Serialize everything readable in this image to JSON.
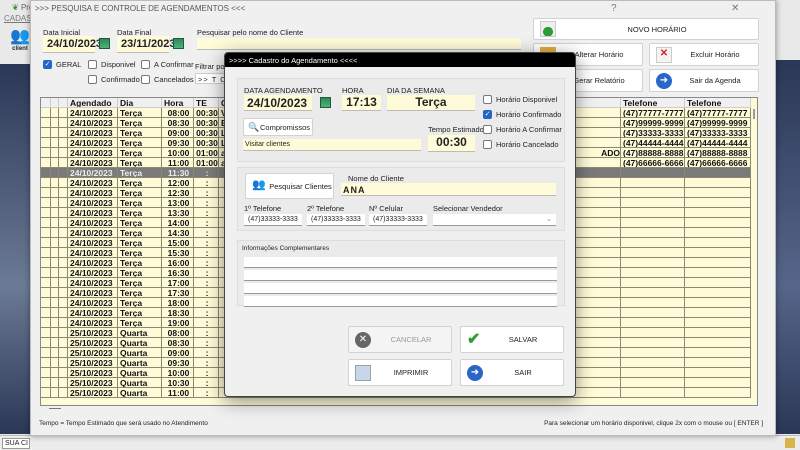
{
  "back_app": {
    "title": "Pro",
    "menu": "CADAS",
    "clientes_label": "client",
    "status_cell": "SUA CI"
  },
  "window": {
    "title": ">>>  PESQUISA E CONTROLE DE AGENDAMENTOS  <<<",
    "help": "?",
    "close": "✕",
    "outer_close": "✕"
  },
  "filters": {
    "data_inicial_label": "Data Inicial",
    "data_inicial": "24/10/2023",
    "data_final_label": "Data Final",
    "data_final": "23/11/2023",
    "search_label": "Pesquisar pelo nome do Cliente",
    "search_value": "",
    "geral": "GERAL",
    "disponivel": "Disponivel",
    "a_confirmar": "A Confirmar",
    "confirmado": "Confirmado",
    "cancelados": "Cancelados",
    "filtrar_label": "Filtrar por",
    "filtrar_value": ">> T O"
  },
  "actions": {
    "novo": "NOVO HORÁRIO",
    "alterar": "Alterar Horário",
    "excluir": "Excluir Horário",
    "relatorio": "Gerar Relatório",
    "sair": "Sair da Agenda"
  },
  "grid": {
    "headers": [
      "",
      "",
      "",
      "Agendado",
      "Dia",
      "Hora",
      "TE",
      "C",
      "",
      "Telefone",
      "Telefone"
    ],
    "rows": [
      [
        "24/10/2023",
        "Terça",
        "08:00",
        "00:30",
        "V",
        "",
        "(47)77777-7777",
        "(47)77777-7777"
      ],
      [
        "24/10/2023",
        "Terça",
        "08:30",
        "00:30",
        "E",
        "",
        "(47)99999-9999",
        "(47)99999-9999"
      ],
      [
        "24/10/2023",
        "Terça",
        "09:00",
        "00:30",
        "Li",
        "",
        "(47)33333-3333",
        "(47)33333-3333"
      ],
      [
        "24/10/2023",
        "Terça",
        "09:30",
        "00:30",
        "Li",
        "",
        "(47)44444-4444",
        "(47)44444-4444"
      ],
      [
        "24/10/2023",
        "Terça",
        "10:00",
        "01:00",
        "a",
        "ADO",
        "(47)88888-8888",
        "(47)88888-8888"
      ],
      [
        "24/10/2023",
        "Terça",
        "11:00",
        "01:00",
        "a",
        "",
        "(47)66666-6666",
        "(47)66666-6666"
      ],
      [
        "24/10/2023",
        "Terça",
        "11:30",
        ":",
        "",
        "",
        "",
        ""
      ],
      [
        "24/10/2023",
        "Terça",
        "12:00",
        ":",
        "",
        "",
        "",
        ""
      ],
      [
        "24/10/2023",
        "Terça",
        "12:30",
        ":",
        "",
        "",
        "",
        ""
      ],
      [
        "24/10/2023",
        "Terça",
        "13:00",
        ":",
        "",
        "",
        "",
        ""
      ],
      [
        "24/10/2023",
        "Terça",
        "13:30",
        ":",
        "",
        "",
        "",
        ""
      ],
      [
        "24/10/2023",
        "Terça",
        "14:00",
        ":",
        "",
        "",
        "",
        ""
      ],
      [
        "24/10/2023",
        "Terça",
        "14:30",
        ":",
        "",
        "",
        "",
        ""
      ],
      [
        "24/10/2023",
        "Terça",
        "15:00",
        ":",
        "",
        "",
        "",
        ""
      ],
      [
        "24/10/2023",
        "Terça",
        "15:30",
        ":",
        "",
        "",
        "",
        ""
      ],
      [
        "24/10/2023",
        "Terça",
        "16:00",
        ":",
        "",
        "",
        "",
        ""
      ],
      [
        "24/10/2023",
        "Terça",
        "16:30",
        ":",
        "",
        "",
        "",
        ""
      ],
      [
        "24/10/2023",
        "Terça",
        "17:00",
        ":",
        "",
        "",
        "",
        ""
      ],
      [
        "24/10/2023",
        "Terça",
        "17:30",
        ":",
        "",
        "",
        "",
        ""
      ],
      [
        "24/10/2023",
        "Terça",
        "18:00",
        ":",
        "",
        "",
        "",
        ""
      ],
      [
        "24/10/2023",
        "Terça",
        "18:30",
        ":",
        "",
        "",
        "",
        ""
      ],
      [
        "24/10/2023",
        "Terça",
        "19:00",
        ":",
        "",
        "",
        "",
        ""
      ],
      [
        "25/10/2023",
        "Quarta",
        "08:00",
        ":",
        "",
        "",
        "",
        ""
      ],
      [
        "25/10/2023",
        "Quarta",
        "08:30",
        ":",
        "",
        "",
        "",
        ""
      ],
      [
        "25/10/2023",
        "Quarta",
        "09:00",
        ":",
        "",
        "",
        "",
        ""
      ],
      [
        "25/10/2023",
        "Quarta",
        "09:30",
        ":",
        "",
        "",
        "",
        ""
      ],
      [
        "25/10/2023",
        "Quarta",
        "10:00",
        ":",
        "",
        "",
        "",
        ""
      ],
      [
        "25/10/2023",
        "Quarta",
        "10:30",
        ":",
        "",
        "",
        "",
        ""
      ],
      [
        "25/10/2023",
        "Quarta",
        "11:00",
        ":",
        "",
        "",
        "",
        ""
      ]
    ],
    "selected_row": 6
  },
  "footer": {
    "left": "Tempo = Tempo Estimado que será usado no Atendimento",
    "right": "Para selecionar um horário disponivel, clique 2x com o mouse ou [ ENTER ]"
  },
  "dialog": {
    "title": ">>>>   Cadastro do Agendamento   <<<<",
    "data_label": "DATA AGENDAMENTO",
    "data": "24/10/2023",
    "hora_label": "HORA",
    "hora": "17:13",
    "dia_label": "DIA DA SEMANA",
    "dia": "Terça",
    "compromissos": "Compromissos",
    "descricao": "Visitar clientes",
    "tempo_label": "Tempo Estimado",
    "tempo": "00:30",
    "status": [
      {
        "label": "Horário Disponivel",
        "checked": false
      },
      {
        "label": "Horário Confirmado",
        "checked": true
      },
      {
        "label": "Horário A Confirmar",
        "checked": false
      },
      {
        "label": "Horário Cancelado",
        "checked": false
      }
    ],
    "pesquisar": "Pesquisar Clientes",
    "nome_label": "Nome do Cliente",
    "nome": "ANA",
    "tel1_label": "1º Telefone",
    "tel1": "(47)33333-3333",
    "tel2_label": "2º Telefone",
    "tel2": "(47)33333-3333",
    "cel_label": "Nº Celular",
    "cel": "(47)33333-3333",
    "vendedor_label": "Selecionar Vendedor",
    "vendedor": "",
    "info_label": "Informações Complementares",
    "cancelar": "CANCELAR",
    "salvar": "SALVAR",
    "imprimir": "IMPRIMIR",
    "sair": "SAIR"
  }
}
